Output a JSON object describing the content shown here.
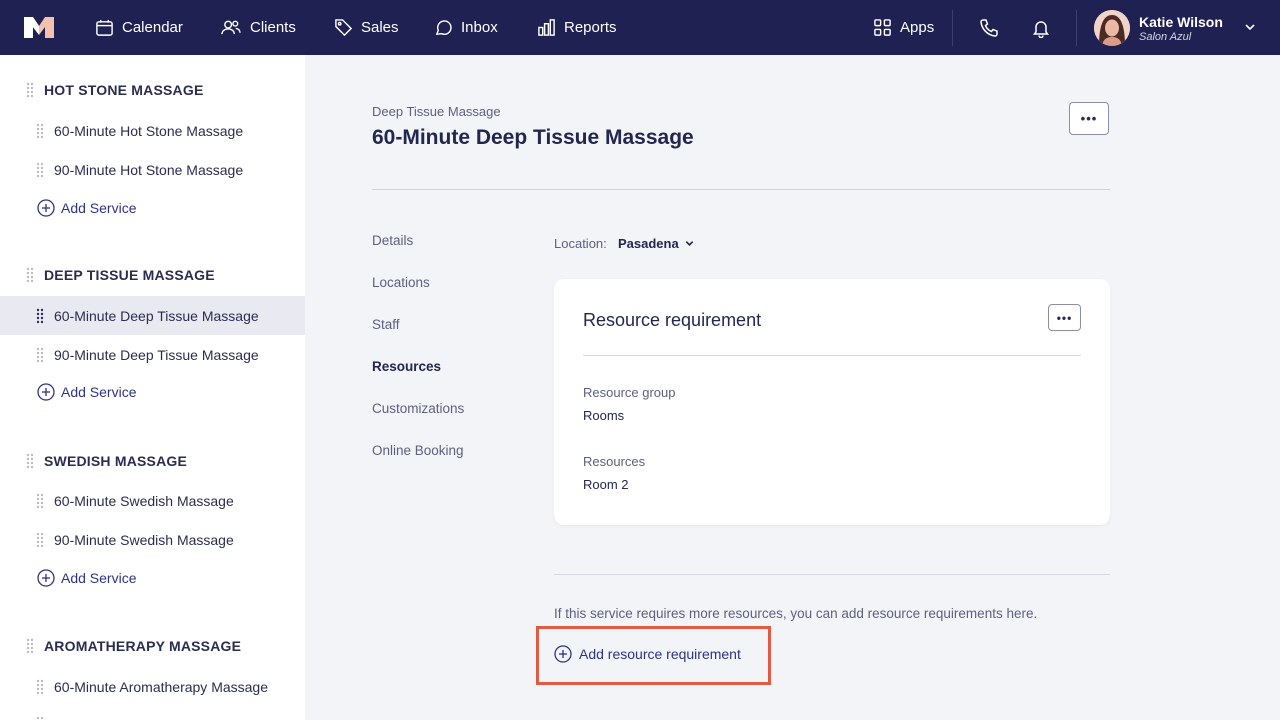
{
  "colors": {
    "nav_bg": "#1f2152",
    "accent": "#2e3384",
    "highlight": "#e05a44",
    "selected_row": "#e9e9f1"
  },
  "nav": {
    "items": [
      {
        "label": "Calendar",
        "icon": "calendar-icon"
      },
      {
        "label": "Clients",
        "icon": "users-icon"
      },
      {
        "label": "Sales",
        "icon": "tag-icon"
      },
      {
        "label": "Inbox",
        "icon": "chat-icon"
      },
      {
        "label": "Reports",
        "icon": "bar-chart-icon"
      }
    ],
    "apps_label": "Apps",
    "user": {
      "name": "Katie Wilson",
      "org": "Salon Azul"
    }
  },
  "sidebar": {
    "add_service_label": "Add Service",
    "categories": [
      {
        "title": "HOT STONE MASSAGE",
        "services": [
          "60-Minute Hot Stone Massage",
          "90-Minute Hot Stone Massage"
        ]
      },
      {
        "title": "DEEP TISSUE MASSAGE",
        "services": [
          "60-Minute Deep Tissue Massage",
          "90-Minute Deep Tissue Massage"
        ]
      },
      {
        "title": "SWEDISH MASSAGE",
        "services": [
          "60-Minute Swedish Massage",
          "90-Minute Swedish Massage"
        ]
      },
      {
        "title": "AROMATHERAPY MASSAGE",
        "services": [
          "60-Minute Aromatherapy Massage"
        ]
      }
    ]
  },
  "main": {
    "breadcrumb": "Deep Tissue Massage",
    "title": "60-Minute Deep Tissue Massage",
    "more_label": "•••",
    "tabs": [
      "Details",
      "Locations",
      "Staff",
      "Resources",
      "Customizations",
      "Online Booking"
    ],
    "active_tab": "Resources",
    "location_label": "Location:",
    "location_value": "Pasadena",
    "card": {
      "title": "Resource requirement",
      "group_label": "Resource group",
      "group_value": "Rooms",
      "resources_label": "Resources",
      "resources_value": "Room 2"
    },
    "helper_text": "If this service requires more resources, you can add resource requirements here.",
    "add_requirement_label": "Add resource requirement"
  }
}
